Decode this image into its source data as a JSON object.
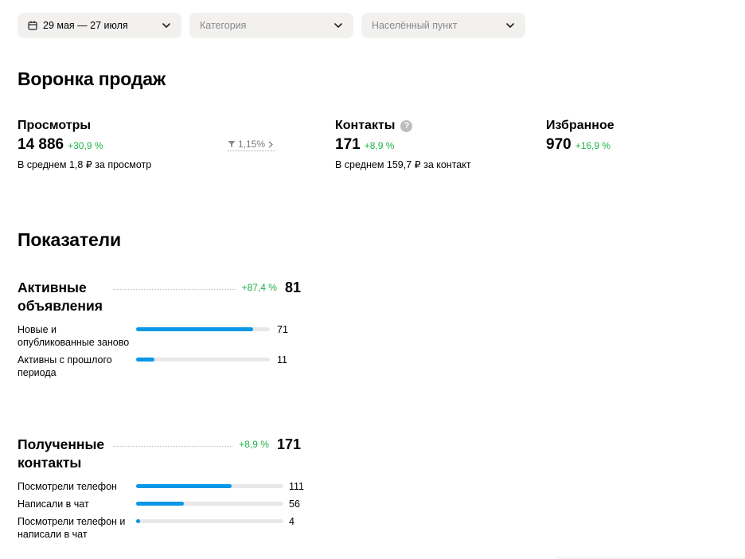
{
  "filters": {
    "date": "29 мая — 27 июля",
    "category_placeholder": "Категория",
    "location_placeholder": "Населённый пункт"
  },
  "funnel": {
    "title": "Воронка продаж",
    "views": {
      "title": "Просмотры",
      "value": "14 886",
      "delta": "+30,9 %",
      "subtitle": "В среднем 1,8 ₽ за просмотр"
    },
    "conversion": "1,15%",
    "contacts": {
      "title": "Контакты",
      "value": "171",
      "delta": "+8,9 %",
      "subtitle": "В среднем 159,7 ₽ за контакт"
    },
    "favorites": {
      "title": "Избранное",
      "value": "970",
      "delta": "+16,9 %"
    }
  },
  "indicators": {
    "title": "Показатели",
    "active_ads": {
      "title": "Активные объявления",
      "delta": "+87,4 %",
      "value": "81",
      "rows": [
        {
          "label": "Новые и опубликованные заново",
          "value": "71",
          "fraction": 0.876
        },
        {
          "label": "Активны с прошлого периода",
          "value": "11",
          "fraction": 0.136
        }
      ]
    },
    "contacts": {
      "title": "Полученные контакты",
      "delta": "+8,9 %",
      "value": "171",
      "rows": [
        {
          "label": "Посмотрели телефон",
          "value": "111",
          "fraction": 0.649
        },
        {
          "label": "Написали в чат",
          "value": "56",
          "fraction": 0.327
        },
        {
          "label": "Посмотрели телефон и написали в чат",
          "value": "4",
          "fraction": 0.023
        }
      ]
    }
  },
  "colors": {
    "accent": "#0a97e6",
    "positive": "#1cb347",
    "filter_bg": "#f2f1f0"
  }
}
